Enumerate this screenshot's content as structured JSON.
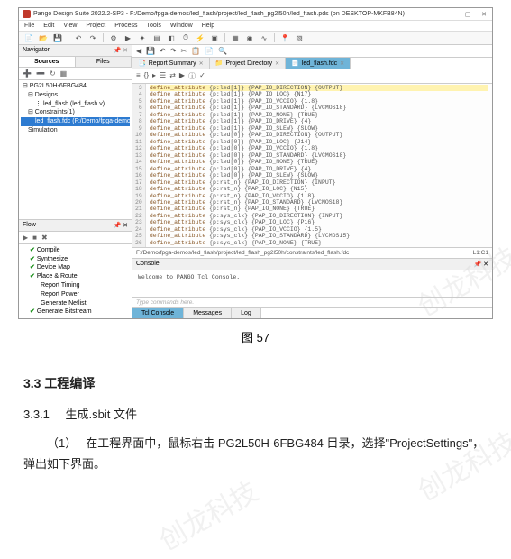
{
  "titlebar": {
    "title": "Pango Design Suite 2022.2-SP3 - F:/Demo/fpga-demos/led_flash/project/led_flash_pg2l50h/led_flash.pds (on DESKTOP-MKFB84N)"
  },
  "menu": [
    "File",
    "Edit",
    "View",
    "Project",
    "Process",
    "Tools",
    "Window",
    "Help"
  ],
  "navigator": {
    "title": "Navigator",
    "tabs": [
      "Sources",
      "Files"
    ],
    "tree": [
      {
        "lvl": 0,
        "text": "⊟ PG2L50H-6FBG484"
      },
      {
        "lvl": 1,
        "text": "⊟ Designs"
      },
      {
        "lvl": 2,
        "text": "⋮ led_flash (led_flash.v)"
      },
      {
        "lvl": 1,
        "text": "⊟ Constraints(1)"
      },
      {
        "lvl": 2,
        "text": "led_flash.fdc (F:/Demo/fpga-demo",
        "sel": true
      },
      {
        "lvl": 1,
        "text": "Simulation"
      }
    ]
  },
  "flow": {
    "title": "Flow",
    "items": [
      {
        "chk": true,
        "ind": 0,
        "text": "Compile"
      },
      {
        "chk": true,
        "ind": 0,
        "text": "Synthesize"
      },
      {
        "chk": true,
        "ind": 0,
        "text": "Device Map"
      },
      {
        "chk": true,
        "ind": 0,
        "text": "Place & Route"
      },
      {
        "chk": false,
        "ind": 1,
        "text": "Report Timing"
      },
      {
        "chk": false,
        "ind": 1,
        "text": "Report Power"
      },
      {
        "chk": false,
        "ind": 1,
        "text": "Generate Netlist"
      },
      {
        "chk": true,
        "ind": 0,
        "text": "Generate Bitstream"
      }
    ]
  },
  "editor": {
    "tabs": [
      {
        "label": "Report Summary",
        "active": false
      },
      {
        "label": "Project Directory",
        "active": false
      },
      {
        "label": "led_flash.fdc",
        "active": true
      }
    ],
    "lines": [
      "define_attribute {p:led[1]} {PAP_IO_DIRECTION} {OUTPUT}",
      "define_attribute {p:led[1]} {PAP_IO_LOC} {N17}",
      "define_attribute {p:led[1]} {PAP_IO_VCCIO} {1.8}",
      "define_attribute {p:led[1]} {PAP_IO_STANDARD} {LVCMOS18}",
      "define_attribute {p:led[1]} {PAP_IO_NONE} {TRUE}",
      "define_attribute {p:led[1]} {PAP_IO_DRIVE} {4}",
      "define_attribute {p:led[1]} {PAP_IO_SLEW} {SLOW}",
      "define_attribute {p:led[0]} {PAP_IO_DIRECTION} {OUTPUT}",
      "define_attribute {p:led[0]} {PAP_IO_LOC} {J14}",
      "define_attribute {p:led[0]} {PAP_IO_VCCIO} {1.8}",
      "define_attribute {p:led[0]} {PAP_IO_STANDARD} {LVCMOS18}",
      "define_attribute {p:led[0]} {PAP_IO_NONE} {TRUE}",
      "define_attribute {p:led[0]} {PAP_IO_DRIVE} {4}",
      "define_attribute {p:led[0]} {PAP_IO_SLEW} {SLOW}",
      "define_attribute {p:rst_n} {PAP_IO_DIRECTION} {INPUT}",
      "define_attribute {p:rst_n} {PAP_IO_LOC} {N15}",
      "define_attribute {p:rst_n} {PAP_IO_VCCIO} {1.8}",
      "define_attribute {p:rst_n} {PAP_IO_STANDARD} {LVCMOS18}",
      "define_attribute {p:rst_n} {PAP_IO_NONE} {TRUE}",
      "define_attribute {p:sys_clk} {PAP_IO_DIRECTION} {INPUT}",
      "define_attribute {p:sys_clk} {PAP_IO_LOC} {P16}",
      "define_attribute {p:sys_clk} {PAP_IO_VCCIO} {1.5}",
      "define_attribute {p:sys_clk} {PAP_IO_STANDARD} {LVCMOS15}",
      "define_attribute {p:sys_clk} {PAP_IO_NONE} {TRUE}"
    ],
    "line_start": 3
  },
  "path_bar": {
    "path": "F:/Demo/fpga-demos/led_flash/project/led_flash_pg2l50h/constraints/led_flash.fdc",
    "pos": "L1:C1"
  },
  "console": {
    "title": "Console",
    "body": "Welcome to PANGO Tcl Console.",
    "placeholder": "Type commands here.",
    "tabs": [
      "Tcl Console",
      "Messages",
      "Log"
    ]
  },
  "caption": "图 57",
  "doc": {
    "h3": "3.3  工程编译",
    "h4_num": "3.3.1",
    "h4_text": "生成.sbit 文件",
    "p1_step": "（1）",
    "p1_text": "在工程界面中，鼠标右击 PG2L50H-6FBG484 目录，选择\"ProjectSettings\"，弹出如下界面。"
  }
}
